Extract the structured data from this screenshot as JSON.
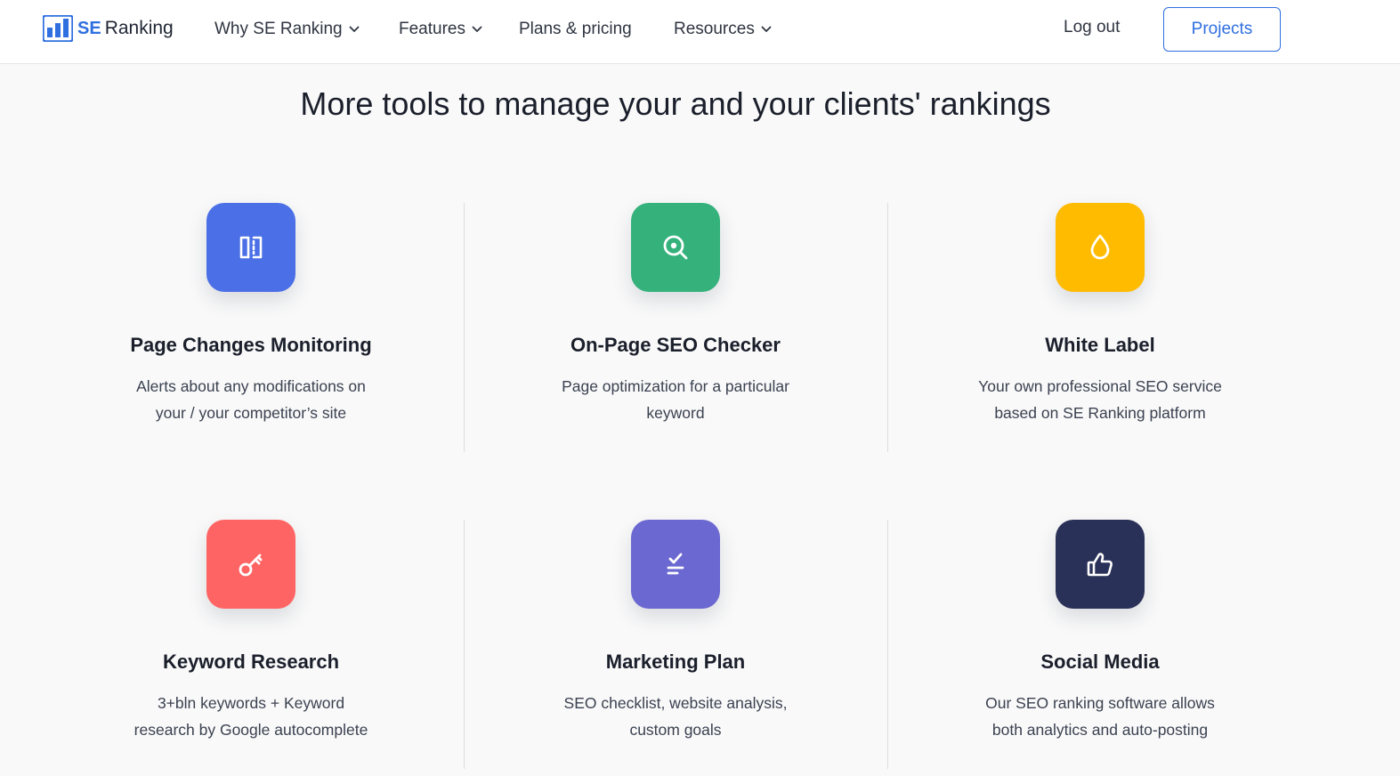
{
  "header": {
    "logo": {
      "brand_short": "SE",
      "brand_rest": "Ranking"
    },
    "nav": [
      {
        "label": "Why SE Ranking",
        "dropdown": true
      },
      {
        "label": "Features",
        "dropdown": true
      },
      {
        "label": "Plans & pricing",
        "dropdown": false
      },
      {
        "label": "Resources",
        "dropdown": true
      }
    ],
    "logout_label": "Log out",
    "projects_label": "Projects"
  },
  "section": {
    "title": "More tools to manage your and your clients' rankings"
  },
  "colors": {
    "brand_blue": "#2f6fe0",
    "page_changes": "#4a6fe6",
    "onpage_seo": "#35b27c",
    "white_label": "#ffbb00",
    "keyword_research": "#ff6464",
    "marketing_plan": "#6b68d1",
    "social_media": "#2a3158"
  },
  "tools": [
    {
      "icon": "split-page-icon",
      "title": "Page Changes Monitoring",
      "desc_line1": "Alerts about any modifications on",
      "desc_line2": "your / your competitor’s site"
    },
    {
      "icon": "search-icon",
      "title": "On-Page SEO Checker",
      "desc_line1": "Page optimization for a particular",
      "desc_line2": "keyword"
    },
    {
      "icon": "drop-icon",
      "title": "White Label",
      "desc_line1": "Your own professional SEO service",
      "desc_line2": "based on SE Ranking platform"
    },
    {
      "icon": "key-icon",
      "title": "Keyword Research",
      "desc_line1": "3+bln keywords + Keyword",
      "desc_line2": "research by Google autocomplete"
    },
    {
      "icon": "checklist-icon",
      "title": "Marketing Plan",
      "desc_line1": "SEO checklist, website analysis,",
      "desc_line2": "custom goals"
    },
    {
      "icon": "thumbs-up-icon",
      "title": "Social Media",
      "desc_line1": "Our SEO ranking software allows",
      "desc_line2": "both analytics and auto-posting"
    }
  ]
}
